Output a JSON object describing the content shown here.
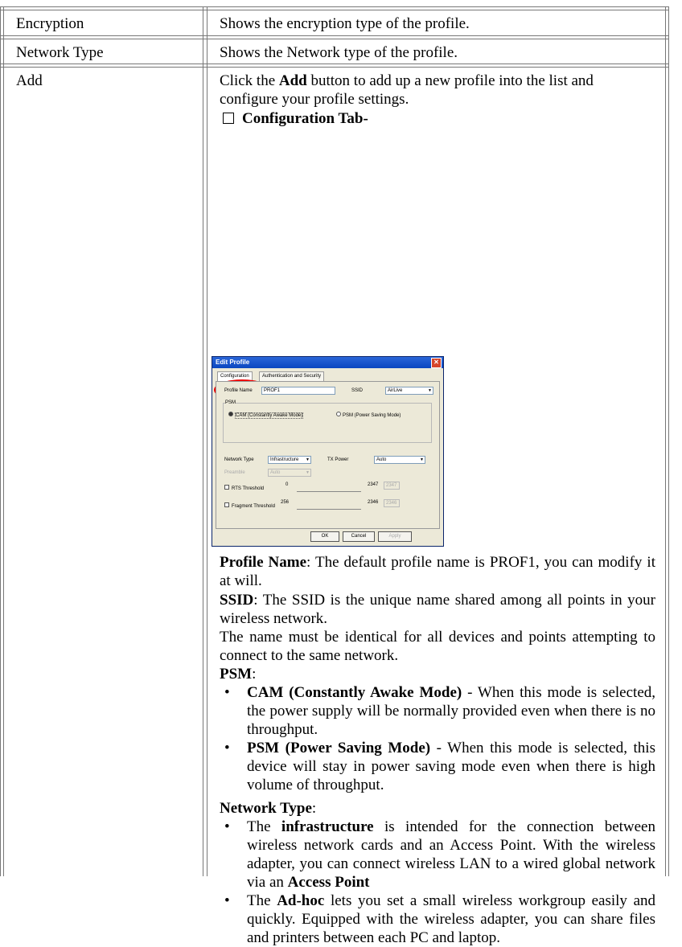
{
  "rows": [
    {
      "label": "Encryption",
      "desc": "Shows the encryption type of the profile."
    },
    {
      "label": "Network Type",
      "desc": "Shows the Network type of the profile."
    },
    {
      "label": "Add"
    }
  ],
  "add": {
    "intro_pre": "Click the ",
    "intro_bold": "Add",
    "intro_post": " button to add up a new profile into the list and configure your profile settings.",
    "config_tab_heading": "Configuration Tab-",
    "profile_name_bold": "Profile Name",
    "profile_name_text": ": The default profile name is PROF1, you can modify it at will.",
    "ssid_bold": "SSID",
    "ssid_text": ": The SSID is the unique name shared among all points in your wireless network.",
    "name_text": "The name must be identical for all devices and points attempting to connect to the same network.",
    "psm_heading": "PSM",
    "psm_colon": ":",
    "psm_items": [
      {
        "bold": "CAM (Constantly Awake Mode)",
        "text": " - When this mode is selected, the power supply will be normally provided even when there is no throughput."
      },
      {
        "bold": "PSM (Power Saving Mode)",
        "text": " - When this mode is selected, this device will stay in power saving mode even when there is high volume of throughput."
      }
    ],
    "network_type_heading": "Network Type",
    "nt_colon": ":",
    "nt_item1": {
      "pre": "The ",
      "bold": "infrastructure",
      "mid": " is intended for the connection between wireless network cards and an Access Point. With the wireless adapter, you can connect wireless LAN to a wired global network via an ",
      "bold2": "Access Point"
    },
    "nt_item2": {
      "pre": "The ",
      "bold": "Ad-hoc",
      "post": " lets you set a small wireless workgroup easily and quickly.  Equipped with the wireless adapter, you can share files and printers between each PC and laptop."
    },
    "bullet": "•"
  },
  "dialog": {
    "title": "Edit Profile",
    "close": "✕",
    "tabs": [
      "Configuration",
      "Authentication and Security"
    ],
    "profile_name_label": "Profile Name",
    "profile_name_value": "PROF1",
    "ssid_label": "SSID",
    "ssid_value": "AirLive",
    "psm_group": "PSM",
    "radio_cam": "CAM (Constantly Awake Mode)",
    "radio_psm": "PSM (Power Saving Mode)",
    "network_type_label": "Network Type",
    "network_type_value": "Infrastructure",
    "tx_power_label": "TX Power",
    "tx_power_value": "Auto",
    "preamble_label": "Preamble",
    "preamble_value": "Auto",
    "rts_label": "RTS Threshold",
    "rts_min": "0",
    "rts_max": "2347",
    "rts_value": "2347",
    "frag_label": "Fragment Threshold",
    "frag_min": "256",
    "frag_max": "2346",
    "frag_value": "2346",
    "ok": "OK",
    "cancel": "Cancel",
    "apply": "Apply",
    "dropdown_glyph": "▼"
  }
}
